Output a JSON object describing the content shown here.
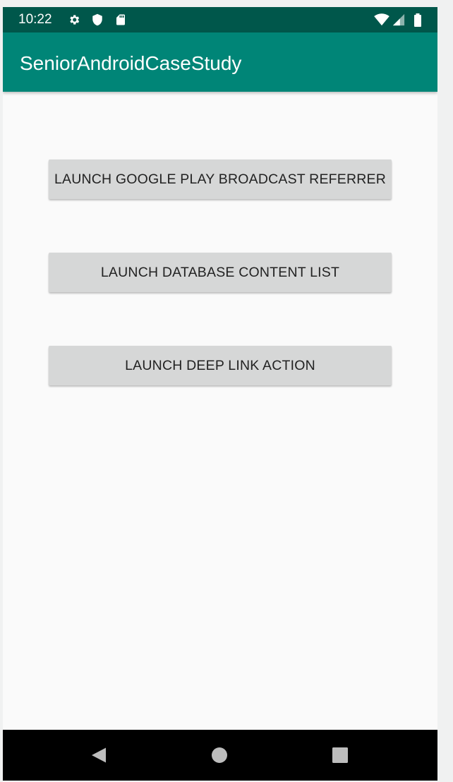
{
  "status_bar": {
    "time": "10:22",
    "icons_left": [
      "gear-icon",
      "shield-icon",
      "sd-card-icon"
    ],
    "icons_right": [
      "wifi-icon",
      "signal-icon",
      "battery-icon"
    ],
    "background": "#00574b"
  },
  "app_bar": {
    "title": "SeniorAndroidCaseStudy",
    "background": "#008577"
  },
  "buttons": [
    {
      "label": "LAUNCH GOOGLE PLAY BROADCAST REFERRER"
    },
    {
      "label": "LAUNCH DATABASE CONTENT LIST"
    },
    {
      "label": "LAUNCH DEEP LINK ACTION"
    }
  ],
  "nav_bar": {
    "items": [
      "back-icon",
      "home-icon",
      "recents-icon"
    ],
    "background": "#000000"
  }
}
